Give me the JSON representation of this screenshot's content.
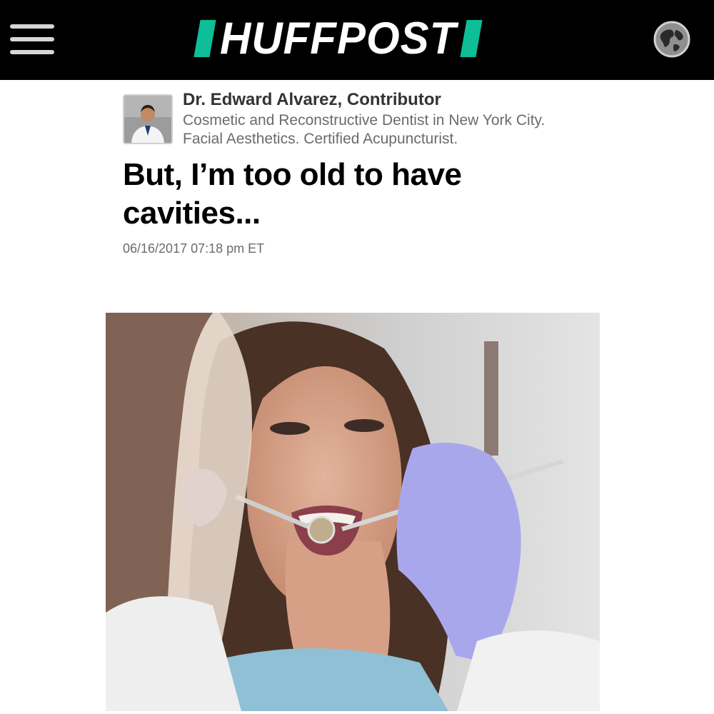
{
  "header": {
    "menu_icon": "hamburger-menu-icon",
    "logo_text": "HUFFPOST",
    "edition_icon": "globe-icon",
    "accent_color": "#0dbe98",
    "background_color": "#000000"
  },
  "byline": {
    "author": "Dr. Edward Alvarez, Contributor",
    "bio": "Cosmetic and Reconstructive Dentist in New York City. Facial Aesthetics. Certified Acupuncturist."
  },
  "article": {
    "title": "But, I’m too old to have cavities...",
    "timestamp": "06/16/2017 07:18 pm ET"
  }
}
